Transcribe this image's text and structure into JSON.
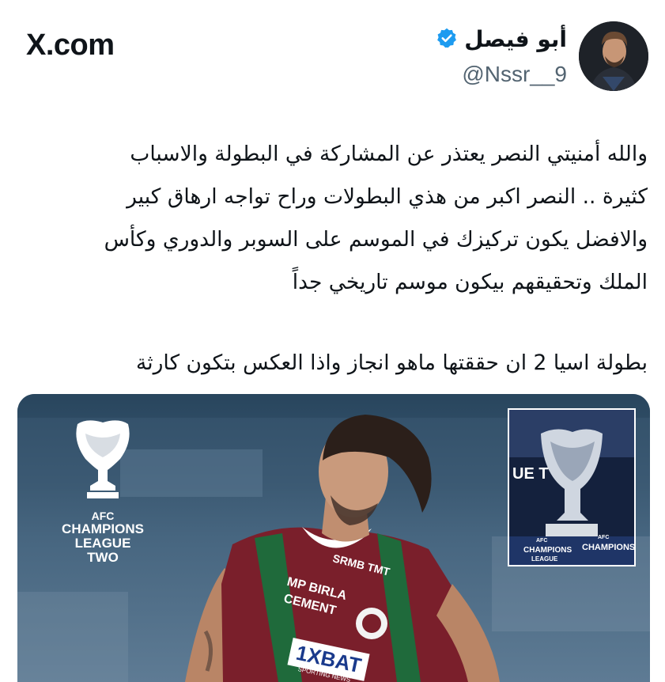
{
  "header": {
    "logo_text": "X.com",
    "display_name": "أبو فيصل",
    "handle": "@Nssr__9",
    "verified": true
  },
  "tweet": {
    "lines": [
      "والله أمنيتي النصر يعتذر عن المشاركة في البطولة والاسباب",
      "كثيرة .. النصر اكبر من هذي البطولات وراح تواجه ارهاق كبير",
      "والافضل يكون تركيزك في الموسم على السوبر والدوري وكأس",
      "الملك وتحقيقهم بيكون موسم تاريخي جداً"
    ],
    "last_line": "بطولة اسيا 2 ان حققتها ماهو انجاز واذا العكس بتكون كارثة"
  },
  "media": {
    "logo_lines": [
      "AFC",
      "CHAMPIONS",
      "LEAGUE",
      "TWO"
    ],
    "inset_text": [
      "UE T",
      "AFC",
      "CHAMPIONS",
      "LEAGUE",
      "AFC",
      "CHAMPIONS"
    ],
    "jersey_text": [
      "SRMB TMT",
      "MP BIRLA",
      "CEMENT",
      "1XBAT",
      "SPORTING NEWS"
    ]
  },
  "colors": {
    "verified_blue": "#1d9bf0",
    "text": "#0f1419",
    "secondary": "#536471",
    "jersey_maroon": "#7a1f2b",
    "jersey_green": "#1f6a3b"
  }
}
